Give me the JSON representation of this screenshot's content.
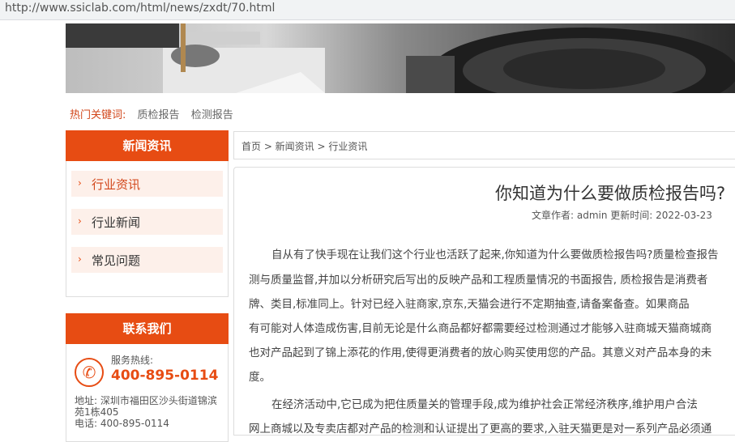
{
  "browser": {
    "url": "http://www.ssiclab.com/html/news/zxdt/70.html"
  },
  "hot_keywords": {
    "label": "热门关键词:",
    "items": [
      "质检报告",
      "检测报告"
    ]
  },
  "sidebar": {
    "news_title": "新闻资讯",
    "items": [
      {
        "label": "行业资讯",
        "active": true
      },
      {
        "label": "行业新闻",
        "active": false
      },
      {
        "label": "常见问题",
        "active": false
      }
    ],
    "contact_title": "联系我们",
    "hotline_label": "服务热线:",
    "hotline_number": "400-895-0114",
    "address_line1": "地址: 深圳市福田区沙头街道锦滨",
    "address_line2": "苑1栋405",
    "phone_line": "电话: 400-895-0114"
  },
  "breadcrumb": "首页 > 新闻资讯 > 行业资讯",
  "article": {
    "title": "你知道为什么要做质检报告吗?",
    "meta": "文章作者: admin 更新时间: 2022-03-23",
    "lines": [
      "自从有了快手现在让我们这个行业也活跃了起来,你知道为什么要做质检报告吗?质量检查报告",
      "测与质量监督,并加以分析研究后写出的反映产品和工程质量情况的书面报告, 质检报告是消费者",
      "牌、类目,标准同上。针对已经入驻商家,京东,天猫会进行不定期抽查,请备案备查。如果商品",
      "有可能对人体造成伤害,目前无论是什么商品都好都需要经过检测通过才能够入驻商城天猫商城商",
      "也对产品起到了锦上添花的作用,使得更消费者的放心购买使用您的产品。其意义对产品本身的未",
      "度。",
      "在经济活动中,它已成为把住质量关的管理手段,成为维护社会正常经济秩序,维护用户合法",
      "网上商城以及专卖店都对产品的检测和认证提出了更高的要求,入驻天猫更是对一系列产品必须通"
    ]
  }
}
